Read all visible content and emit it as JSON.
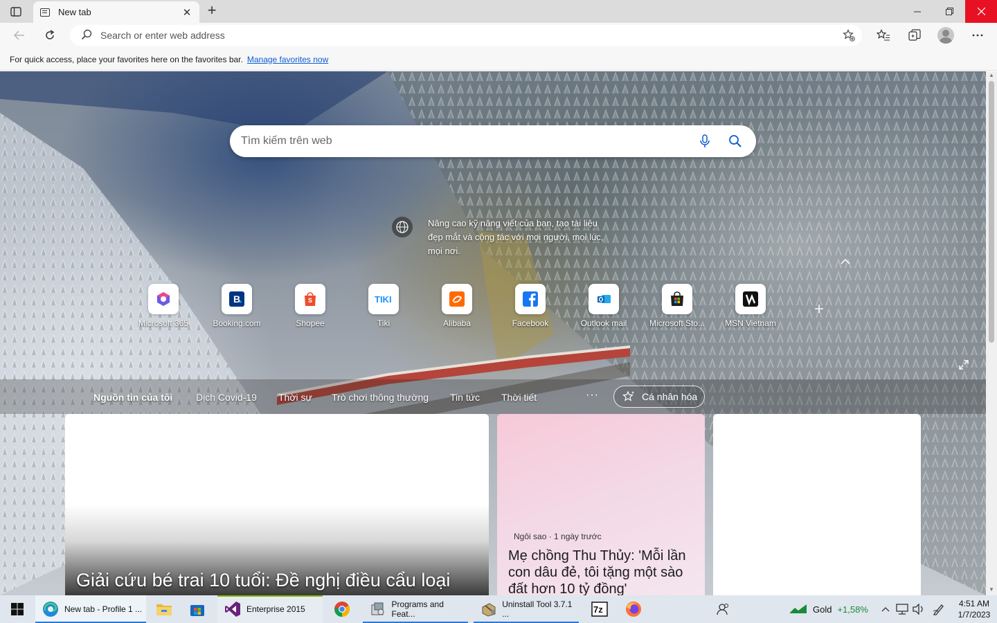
{
  "tab": {
    "title": "New tab"
  },
  "address_bar": {
    "placeholder": "Search or enter web address"
  },
  "favorites_bar": {
    "message": "For quick access, place your favorites here on the favorites bar.",
    "link": "Manage favorites now"
  },
  "page": {
    "search_placeholder": "Tìm kiếm trên web",
    "promo_text": "Nâng cao kỹ năng viết của bạn, tạo tài liệu đẹp mắt và cộng tác với mọi người, mọi lúc, mọi nơi.",
    "quick_links": [
      {
        "label": "Microsoft 365",
        "icon": "microsoft-365-icon"
      },
      {
        "label": "Booking.com",
        "icon": "booking-icon"
      },
      {
        "label": "Shopee",
        "icon": "shopee-icon"
      },
      {
        "label": "Tiki",
        "icon": "tiki-icon"
      },
      {
        "label": "Alibaba",
        "icon": "alibaba-icon"
      },
      {
        "label": "Facebook",
        "icon": "facebook-icon"
      },
      {
        "label": "Outlook mail",
        "icon": "outlook-icon"
      },
      {
        "label": "Microsoft Sto...",
        "icon": "microsoft-store-icon"
      },
      {
        "label": "MSN Vietnam",
        "icon": "msn-icon"
      }
    ],
    "feed_tabs": [
      "Nguồn tin của tôi",
      "Dịch Covid-19",
      "Thời sự",
      "Trò chơi thông thường",
      "Tin tức",
      "Thời tiết"
    ],
    "more": "···",
    "personalize": "Cá nhân hóa",
    "cards": [
      {
        "headline": "Giải cứu bé trai 10 tuổi: Đề nghị điều cẩu loại"
      },
      {
        "meta": "Ngôi sao · 1 ngày trước",
        "headline": "Mẹ chồng Thu Thủy: 'Mỗi lần con dâu đẻ, tôi tặng một sào đất hơn 10 tỷ đồng'"
      },
      {
        "headline": ""
      }
    ]
  },
  "taskbar": {
    "items": [
      {
        "label": "New tab - Profile 1 ...",
        "icon": "edge-icon"
      },
      {
        "label": "",
        "icon": "file-explorer-icon"
      },
      {
        "label": "",
        "icon": "microsoft-store-icon"
      },
      {
        "label": "Enterprise 2015",
        "icon": "visual-studio-icon"
      },
      {
        "label": "",
        "icon": "chrome-icon"
      },
      {
        "label": "Programs and Feat...",
        "icon": "programs-features-icon"
      },
      {
        "label": "Uninstall Tool 3.7.1 ...",
        "icon": "uninstall-tool-icon"
      },
      {
        "label": "",
        "icon": "7zip-icon"
      },
      {
        "label": "",
        "icon": "firefox-icon"
      }
    ],
    "gold": {
      "label": "Gold",
      "change": "+1,58%"
    },
    "clock": {
      "time": "4:51 AM",
      "date": "1/7/2023"
    }
  },
  "colors": {
    "accent": "#0b5ccf",
    "close": "#e81123",
    "gold_change": "#1a8a3a"
  }
}
